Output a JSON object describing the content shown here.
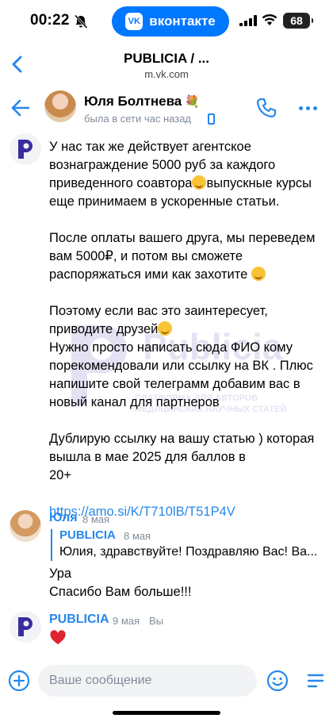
{
  "status_bar": {
    "time": "00:22",
    "vk_label": "вконтакте",
    "vk_logo": "VK",
    "battery": "68"
  },
  "browser": {
    "title": "PUBLICIA / ...",
    "url": "m.vk.com"
  },
  "chat_header": {
    "contact_name": "Юля Болтнева",
    "status": "была в сети час назад"
  },
  "messages": {
    "publicia_main": {
      "lines": [
        "У нас так же действует агентское",
        "вознаграждение 5000 руб за каждого",
        "приведенного соавтора",
        "выпускные курсы",
        "еще принимаем в ускоренные статьи.",
        "После оплаты вашего друга, мы переведем",
        "вам 5000₽, и потом вы сможете",
        "распоряжаться ими как захотите",
        "Поэтому если вас это заинтересует,",
        "приводите друзей",
        "Нужно просто написать сюда ФИО кому",
        "порекомендовали или ссылку на ВК . Плюс",
        "напишите свой телеграмм добавим вас в",
        "новый канал для партнеров",
        "Дублирую ссылку на вашу статью ) которая",
        "вышла в мае 2025 для баллов в",
        "20+",
        "https://amo.si/K/T710lB/T51P4V"
      ]
    },
    "yulia": {
      "name": "Юля",
      "time": "8 мая",
      "reply_name": "PUBLICIA",
      "reply_time": "8 мая",
      "reply_text": "Юлия, здравствуйте! Поздравляю Вас! Ва...",
      "line1": "Ура",
      "line2": "Спасибо Вам больше!!!"
    },
    "publicia_last": {
      "name": "PUBLICIA",
      "time": "9 мая",
      "seen": "Вы"
    }
  },
  "watermark": {
    "name": "Publicia",
    "sub1": "ПЛАТФОРМА ДЛЯ АВТОРОВ",
    "sub2": "МЕДИЦИНСКИХ НАУЧНЫХ СТАТЕЙ"
  },
  "input": {
    "placeholder": "Ваше сообщение"
  },
  "colors": {
    "accent": "#2688eb",
    "vk_blue": "#0077ff",
    "brand_purple": "#3a2ca0"
  }
}
